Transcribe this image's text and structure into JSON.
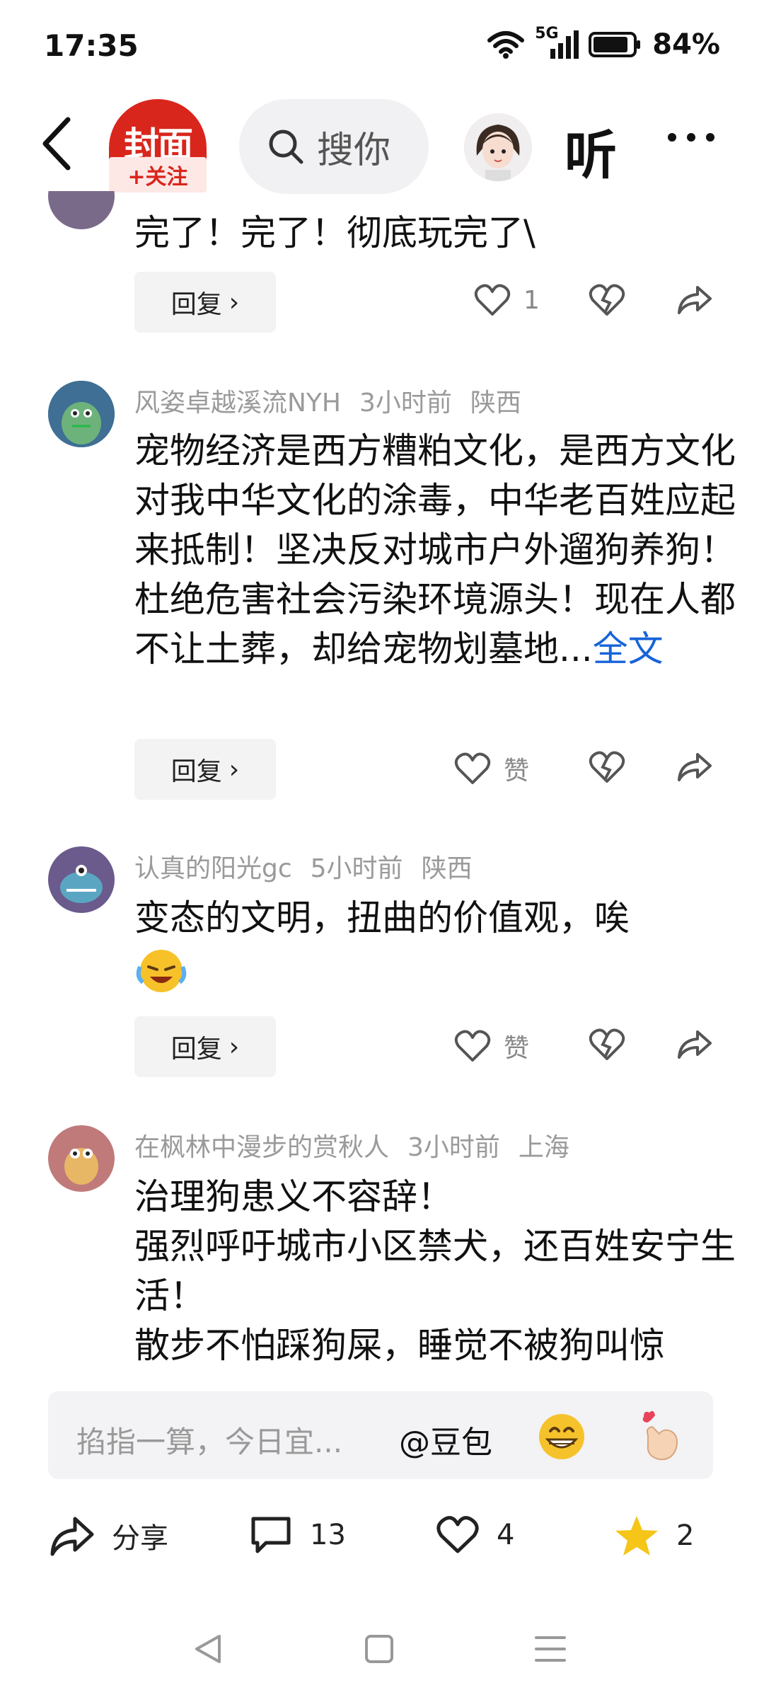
{
  "status_bar": {
    "time": "17:35",
    "network": "5G",
    "battery": "84%"
  },
  "header": {
    "logo_text": "封面",
    "follow_label": "+关注",
    "search_placeholder": "搜你",
    "listen_label": "听",
    "more_label": "···"
  },
  "comments": [
    {
      "author": "",
      "time": "",
      "location": "",
      "text": "完了！完了！彻底玩完了\\",
      "reply_label": "回复",
      "like_count": "1"
    },
    {
      "author": "风姿卓越溪流NYH",
      "time": "3小时前",
      "location": "陕西",
      "text": "宠物经济是西方糟粕文化，是西方文化对我中华文化的涂毒，中华老百姓应起来抵制！坚决反对城市户外遛狗养狗！杜绝危害社会污染环境源头！现在人都不让土葬，却给宠物划墓地...",
      "full_text_label": "全文",
      "reply_label": "回复",
      "like_count": "赞"
    },
    {
      "author": "认真的阳光gc",
      "time": "5小时前",
      "location": "陕西",
      "text": "变态的文明，扭曲的价值观，唉",
      "reply_label": "回复",
      "like_count": "赞"
    },
    {
      "author": "在枫林中漫步的赏秋人",
      "time": "3小时前",
      "location": "上海",
      "text_lines": [
        "治理狗患义不容辞！",
        "强烈呼吁城市小区禁犬，还百姓安宁生活！",
        "散步不怕踩狗屎，睡觉不被狗叫惊"
      ]
    }
  ],
  "input_bar": {
    "placeholder": "掐指一算，今日宜...",
    "mention": "@豆包"
  },
  "bottom_bar": {
    "share_label": "分享",
    "comment_count": "13",
    "like_count": "4",
    "favorite_count": "2"
  },
  "colors": {
    "brand_red": "#d9261c",
    "link_blue": "#1763d9",
    "star_yellow": "#f5c518"
  }
}
